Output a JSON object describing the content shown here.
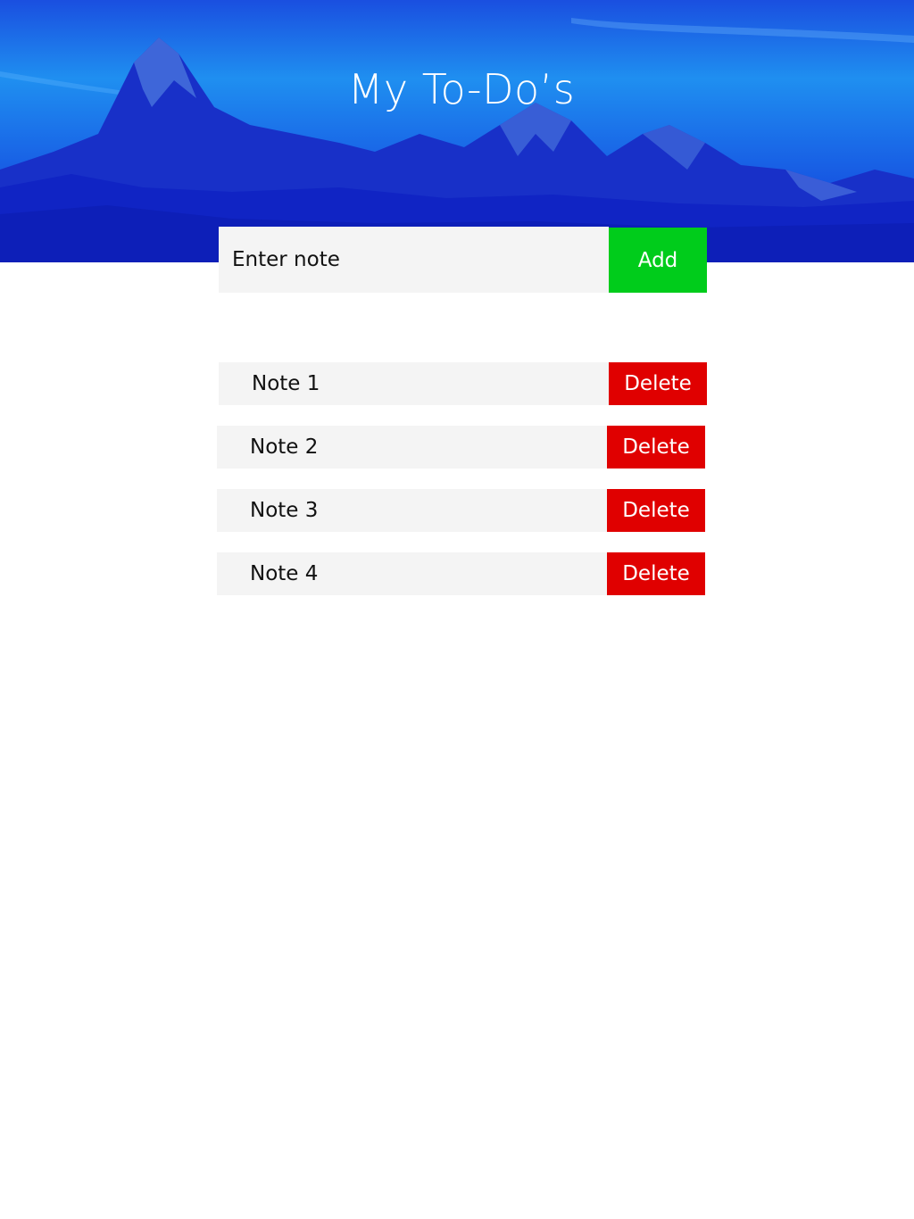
{
  "header": {
    "title": "My To-Do’s",
    "background": "mountain-landscape-image"
  },
  "add_form": {
    "placeholder": "Enter note",
    "value": "",
    "add_label": "Add"
  },
  "todos": [
    {
      "text": "Note 1",
      "delete_label": "Delete"
    },
    {
      "text": "Note 2",
      "delete_label": "Delete"
    },
    {
      "text": "Note 3",
      "delete_label": "Delete"
    },
    {
      "text": "Note 4",
      "delete_label": "Delete"
    }
  ],
  "colors": {
    "add": "#00cc1b",
    "delete": "#e00000",
    "field": "#f4f4f4",
    "hero": "#1a3fe0"
  }
}
